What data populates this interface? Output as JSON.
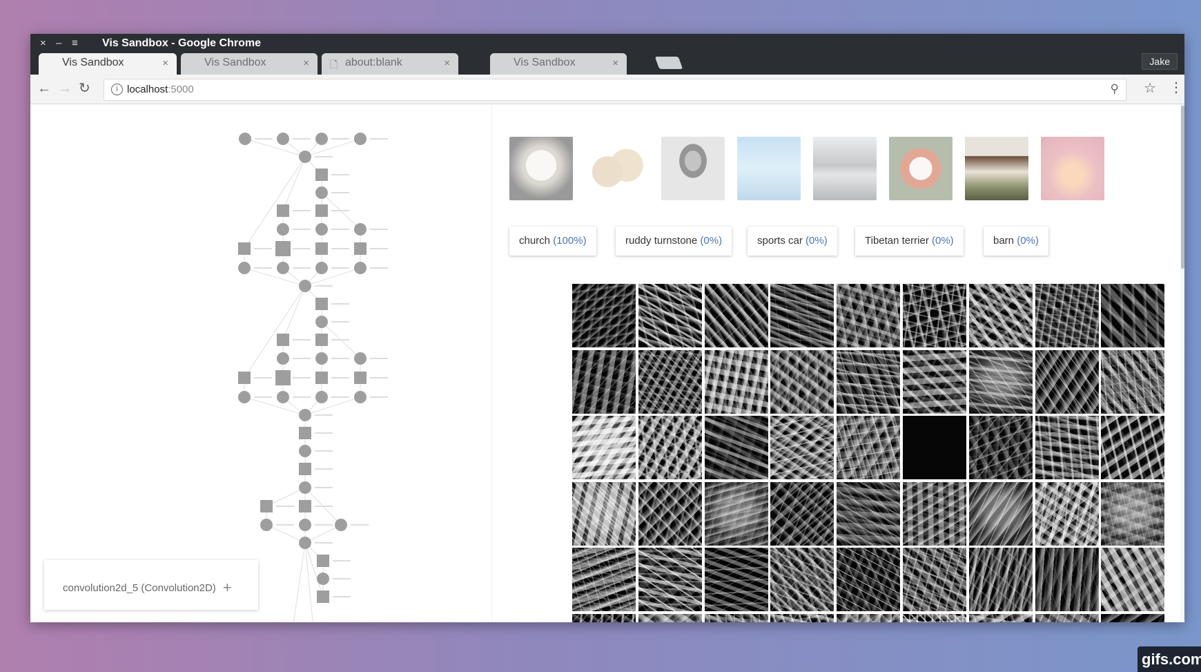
{
  "window": {
    "title": "Vis Sandbox - Google Chrome",
    "controls": [
      "×",
      "–",
      "≡"
    ]
  },
  "tabs": [
    {
      "label": "Vis Sandbox",
      "active": true,
      "icon": null
    },
    {
      "label": "Vis Sandbox",
      "active": false,
      "icon": null
    },
    {
      "label": "about:blank",
      "active": false,
      "icon": "file-icon"
    },
    {
      "label": "Vis Sandbox",
      "active": false,
      "icon": null
    }
  ],
  "profile": "Jake",
  "address": {
    "host": "localhost",
    "port": ":5000"
  },
  "toolbar_icons": [
    "back-icon",
    "forward-icon",
    "reload-icon",
    "info-icon",
    "zoom-icon",
    "star-icon",
    "menu-icon"
  ],
  "layer_card": {
    "label": "convolution2d_5 (Convolution2D)",
    "add": "+"
  },
  "images": [
    {
      "name": "puppy",
      "selected": false
    },
    {
      "name": "potatoes",
      "selected": false
    },
    {
      "name": "lincoln",
      "selected": false
    },
    {
      "name": "deer-water",
      "selected": false
    },
    {
      "name": "mountain-lake",
      "selected": false
    },
    {
      "name": "red-panda",
      "selected": false
    },
    {
      "name": "house",
      "selected": true
    },
    {
      "name": "horse-sunset",
      "selected": false
    }
  ],
  "predictions": [
    {
      "label": "church",
      "pct": "(100%)"
    },
    {
      "label": "ruddy turnstone",
      "pct": "(0%)"
    },
    {
      "label": "sports car",
      "pct": "(0%)"
    },
    {
      "label": "Tibetan terrier",
      "pct": "(0%)"
    },
    {
      "label": "barn",
      "pct": "(0%)"
    }
  ],
  "activation_grid": {
    "rows_visible": 5,
    "cols": 9
  },
  "watermark": "gifs.com",
  "colors": {
    "titlebar": "#2b2f33",
    "accent": "#4a73b8",
    "node": "#9e9e9e"
  }
}
